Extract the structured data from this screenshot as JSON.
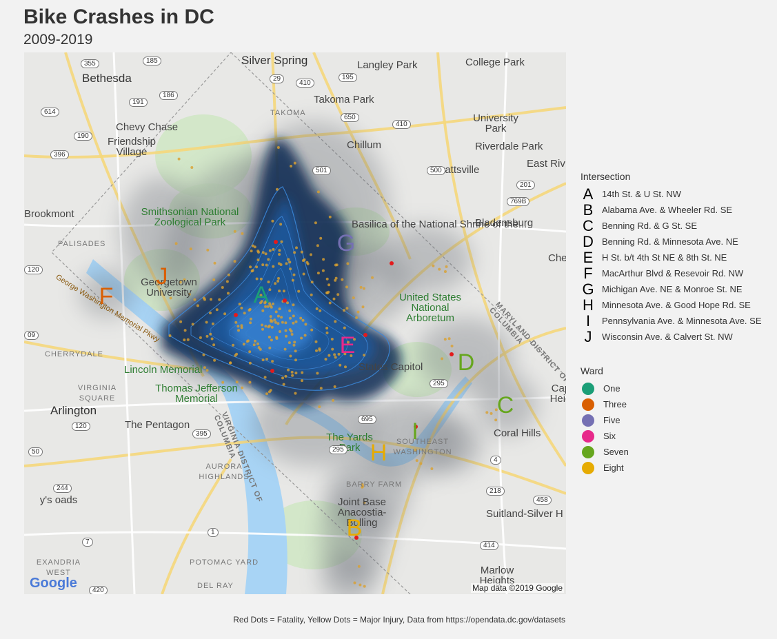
{
  "title": "Bike Crashes in DC",
  "subtitle": "2009-2019",
  "caption": "Red Dots = Fatality, Yellow Dots = Major Injury, Data from https://opendata.dc.gov/datasets",
  "map": {
    "attribution": "Map data ©2019 Google",
    "logo": "Google",
    "place_labels": [
      {
        "name": "silver-spring",
        "text": "Silver Spring",
        "style": "big"
      },
      {
        "name": "langley-park",
        "text": "Langley Park",
        "style": ""
      },
      {
        "name": "college-park",
        "text": "College Park",
        "style": ""
      },
      {
        "name": "bethesda",
        "text": "Bethesda",
        "style": "big"
      },
      {
        "name": "takoma-park",
        "text": "Takoma Park",
        "style": ""
      },
      {
        "name": "takoma",
        "text": "TAKOMA",
        "style": "small"
      },
      {
        "name": "university-park",
        "text": "University Park",
        "style": ""
      },
      {
        "name": "chevy-chase",
        "text": "Chevy Chase",
        "style": ""
      },
      {
        "name": "friendship-village",
        "text": "Friendship Village",
        "style": ""
      },
      {
        "name": "chillum",
        "text": "Chillum",
        "style": ""
      },
      {
        "name": "riverdale-park",
        "text": "Riverdale Park",
        "style": ""
      },
      {
        "name": "hyattsville",
        "text": "Hyattsville",
        "style": ""
      },
      {
        "name": "east-riv",
        "text": "East Riv",
        "style": ""
      },
      {
        "name": "brookmont",
        "text": "Brookmont",
        "style": ""
      },
      {
        "name": "zoo",
        "text": "Smithsonian National Zoological Park",
        "style": "green"
      },
      {
        "name": "basilica",
        "text": "Basilica of the National Shrine of the...",
        "style": ""
      },
      {
        "name": "bladensburg",
        "text": "Bladensburg",
        "style": ""
      },
      {
        "name": "palisades",
        "text": "PALISADES",
        "style": "small"
      },
      {
        "name": "georgetown",
        "text": "Georgetown University",
        "style": ""
      },
      {
        "name": "cheverly",
        "text": "Cheverl",
        "style": ""
      },
      {
        "name": "arboretum",
        "text": "United States National Arboretum",
        "style": "green"
      },
      {
        "name": "cherrydale",
        "text": "CHERRYDALE",
        "style": "small"
      },
      {
        "name": "lincoln",
        "text": "Lincoln Memorial",
        "style": "green"
      },
      {
        "name": "capitol",
        "text": "States Capitol",
        "style": ""
      },
      {
        "name": "virginia-square",
        "text": "VIRGINIA SQUARE",
        "style": "small"
      },
      {
        "name": "jefferson",
        "text": "Thomas Jefferson Memorial",
        "style": "green"
      },
      {
        "name": "arlington",
        "text": "Arlington",
        "style": "big"
      },
      {
        "name": "capitol-heights",
        "text": "Capitol Heights",
        "style": ""
      },
      {
        "name": "pentagon",
        "text": "The Pentagon",
        "style": ""
      },
      {
        "name": "yards-park",
        "text": "The Yards Park",
        "style": "green"
      },
      {
        "name": "southeast",
        "text": "SOUTHEAST WASHINGTON",
        "style": "small"
      },
      {
        "name": "coral-hills",
        "text": "Coral Hills",
        "style": ""
      },
      {
        "name": "aurora",
        "text": "AURORA HIGHLANDS",
        "style": "small"
      },
      {
        "name": "barry-farm",
        "text": "BARRY FARM",
        "style": "small"
      },
      {
        "name": "jbab",
        "text": "Joint Base Anacostia-Bolling",
        "style": ""
      },
      {
        "name": "suitland",
        "text": "Suitland-Silver H",
        "style": ""
      },
      {
        "name": "crossroads",
        "text": "y's oads",
        "style": ""
      },
      {
        "name": "alexandria-west",
        "text": "EXANDRIA WEST",
        "style": "small"
      },
      {
        "name": "potomac-yard",
        "text": "POTOMAC YARD",
        "style": "small"
      },
      {
        "name": "marlow-heights",
        "text": "Marlow Heights",
        "style": ""
      },
      {
        "name": "del-ray",
        "text": "DEL RAY",
        "style": "small"
      },
      {
        "name": "gw-parkway",
        "text": "George Washington Memorial Pkwy",
        "style": "road"
      },
      {
        "name": "dc-md-border",
        "text": "MARYLAND DISTRICT OF COLUMBIA",
        "style": "small"
      },
      {
        "name": "dc-va-border",
        "text": "VIRGINIA DISTRICT OF COLUMBIA",
        "style": "small"
      }
    ],
    "route_shields": [
      "355",
      "185",
      "29",
      "410",
      "195",
      "191",
      "186",
      "614",
      "190",
      "396",
      "650",
      "410",
      "501",
      "500",
      "201",
      "769B",
      "120",
      "09",
      "295",
      "695",
      "120",
      "395",
      "50",
      "295",
      "244",
      "4",
      "218",
      "458",
      "1",
      "7",
      "414",
      "420"
    ]
  },
  "intersections": [
    {
      "letter": "A",
      "label": "14th St. & U St. NW",
      "ward": "One",
      "color": "#1b9e77"
    },
    {
      "letter": "B",
      "label": "Alabama Ave. & Wheeler Rd. SE",
      "ward": "Eight",
      "color": "#e6ab02"
    },
    {
      "letter": "C",
      "label": "Benning Rd. & G St. SE",
      "ward": "Seven",
      "color": "#66a61e"
    },
    {
      "letter": "D",
      "label": "Benning Rd. & Minnesota Ave. NE",
      "ward": "Seven",
      "color": "#66a61e"
    },
    {
      "letter": "E",
      "label": "H St. b/t 4th St NE & 8th St. NE",
      "ward": "Six",
      "color": "#e7298a"
    },
    {
      "letter": "F",
      "label": "MacArthur Blvd & Resevoir Rd. NW",
      "ward": "Three",
      "color": "#d95f02"
    },
    {
      "letter": "G",
      "label": "Michigan Ave. NE & Monroe St. NE",
      "ward": "Five",
      "color": "#7570b3"
    },
    {
      "letter": "H",
      "label": "Minnesota Ave. & Good Hope Rd. SE",
      "ward": "Eight",
      "color": "#e6ab02"
    },
    {
      "letter": "I",
      "label": "Pennsylvania Ave. & Minnesota Ave. SE",
      "ward": "Seven",
      "color": "#66a61e"
    },
    {
      "letter": "J",
      "label": "Wisconsin Ave. & Calvert St. NW",
      "ward": "Three",
      "color": "#d95f02"
    }
  ],
  "legend": {
    "intersection_title": "Intersection",
    "ward_title": "Ward",
    "wards": [
      {
        "label": "One",
        "color": "#1b9e77"
      },
      {
        "label": "Three",
        "color": "#d95f02"
      },
      {
        "label": "Five",
        "color": "#7570b3"
      },
      {
        "label": "Six",
        "color": "#e7298a"
      },
      {
        "label": "Seven",
        "color": "#66a61e"
      },
      {
        "label": "Eight",
        "color": "#e6ab02"
      }
    ]
  },
  "colors": {
    "fatality": "#e31a1c",
    "major_injury": "#d9a030",
    "density_low": "#6b6f78",
    "density_high": "#0e2a52",
    "contour": "#3a86d8",
    "water": "#a8d4f5",
    "park": "#cde6c2"
  }
}
